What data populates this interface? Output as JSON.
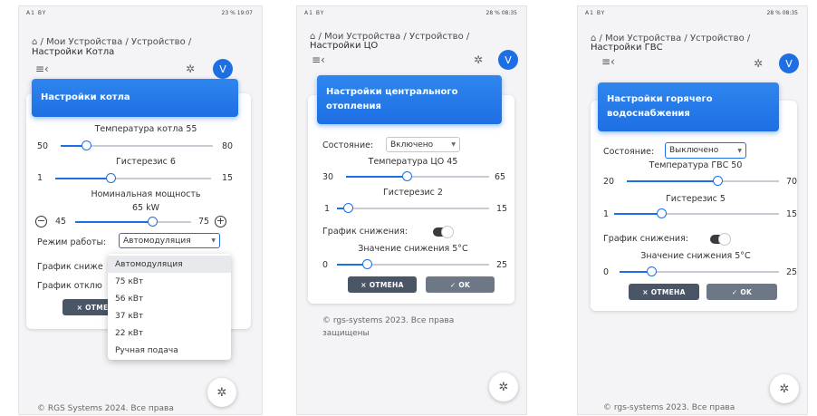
{
  "phone1": {
    "status": {
      "left": "A1 BY",
      "right": "23 % 19:07"
    },
    "breadcrumb": {
      "path": "/ Мои Устройства / Устройство /",
      "title": "Настройки Котла"
    },
    "avatar": "V",
    "header_title": "Настройки котла",
    "boiler_temp": {
      "label": "Температура котла 55",
      "min": "50",
      "max": "80",
      "value": 55,
      "range": [
        50,
        80
      ]
    },
    "hysteresis": {
      "label": "Гистерезис 6",
      "min": "1",
      "max": "15",
      "value": 6,
      "range": [
        1,
        15
      ]
    },
    "power": {
      "label": "Номинальная мощность",
      "value_label": "65 kW",
      "min": "45",
      "max": "75",
      "value": 65,
      "range": [
        45,
        75
      ],
      "minus": "−",
      "plus": "+"
    },
    "mode": {
      "label": "Режим работы:",
      "selected": "Автомодуляция"
    },
    "row_reduce": "График сниже",
    "row_off": "График отклю",
    "cancel_label": "× ОТМЕ",
    "dropdown_options": [
      "Автомодуляция",
      "75 кВт",
      "56 кВт",
      "37 кВт",
      "22 кВт",
      "Ручная подача"
    ],
    "footer": "© RGS Systems 2024. Все права"
  },
  "phone2": {
    "status": {
      "left": "A1 BY",
      "right": "28 % 08:35"
    },
    "breadcrumb": {
      "path": "/ Мои Устройства / Устройство /",
      "title": "Настройки ЦО"
    },
    "avatar": "V",
    "header_title_1": "Настройки центрального",
    "header_title_2": "отопления",
    "state": {
      "label": "Состояние:",
      "selected": "Включено"
    },
    "co_temp": {
      "label": "Температура ЦО 45",
      "min": "30",
      "max": "65",
      "value": 45,
      "range": [
        30,
        65
      ]
    },
    "hysteresis": {
      "label": "Гистерезис 2",
      "min": "1",
      "max": "15",
      "value": 2,
      "range": [
        1,
        15
      ]
    },
    "reduce_schedule": {
      "label": "График снижения:",
      "on": true
    },
    "reduce_value": {
      "label": "Значение снижения 5°C",
      "min": "0",
      "max": "25",
      "value": 5,
      "range": [
        0,
        25
      ]
    },
    "cancel_label": "× ОТМЕНА",
    "ok_label": "✓ OK",
    "footer_1": "© rgs-systems 2023. Все права",
    "footer_2": "защищены"
  },
  "phone3": {
    "status": {
      "left": "A1 BY",
      "right": "28 % 08:35"
    },
    "breadcrumb": {
      "path": "/ Мои Устройства / Устройство /",
      "title": "Настройки ГВС"
    },
    "avatar": "V",
    "header_title_1": "Настройки горячего",
    "header_title_2": "водоснабжения",
    "state": {
      "label": "Состояние:",
      "selected": "Выключено"
    },
    "dhw_temp": {
      "label": "Температура ГВС 50",
      "min": "20",
      "max": "70",
      "value": 50,
      "range": [
        20,
        70
      ]
    },
    "hysteresis": {
      "label": "Гистерезис 5",
      "min": "1",
      "max": "15",
      "value": 5,
      "range": [
        1,
        15
      ]
    },
    "reduce_schedule": {
      "label": "График снижения:",
      "on": true
    },
    "reduce_value": {
      "label": "Значение снижения 5°C",
      "min": "0",
      "max": "25",
      "value": 5,
      "range": [
        0,
        25
      ]
    },
    "cancel_label": "× ОТМЕНА",
    "ok_label": "✓ OK",
    "footer": "© rgs-systems 2023. Все права"
  }
}
